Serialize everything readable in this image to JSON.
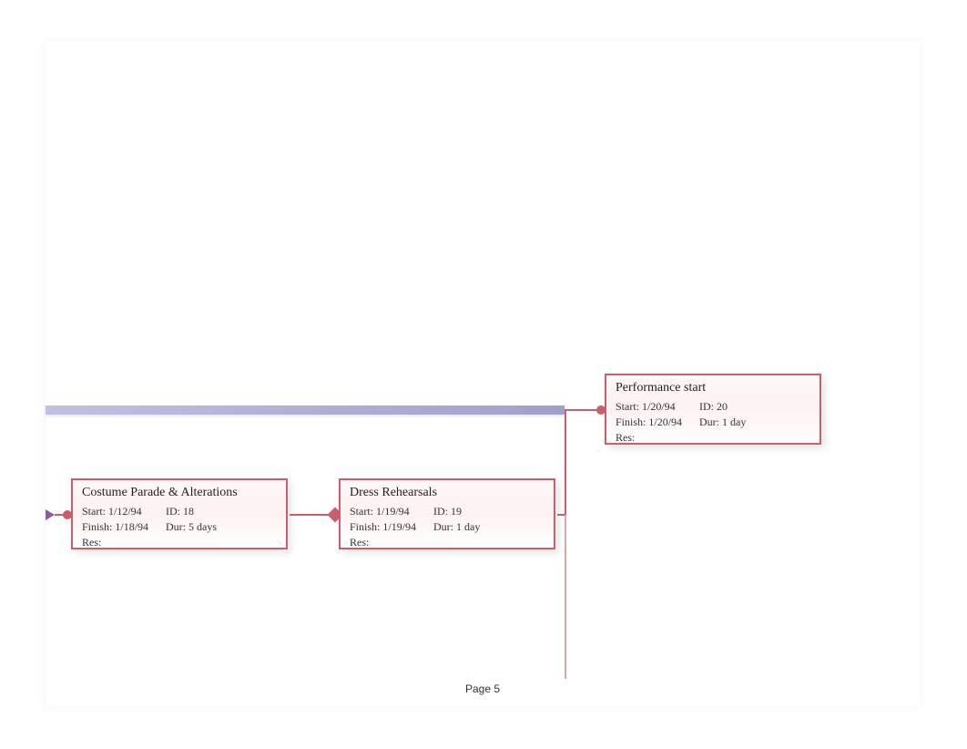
{
  "footer": {
    "page_label": "Page 5"
  },
  "labels": {
    "start": "Start:",
    "finish": "Finish:",
    "id": "ID:",
    "dur": "Dur:",
    "res": "Res:"
  },
  "tasks": {
    "t1": {
      "title": "Costume Parade & Alterations",
      "start": "1/12/94",
      "finish": "1/18/94",
      "id": "18",
      "dur": "5 days",
      "res": ""
    },
    "t2": {
      "title": "Dress Rehearsals",
      "start": "1/19/94",
      "finish": "1/19/94",
      "id": "19",
      "dur": "1 day",
      "res": ""
    },
    "t3": {
      "title": "Performance start",
      "start": "1/20/94",
      "finish": "1/20/94",
      "id": "20",
      "dur": "1 day",
      "res": ""
    }
  }
}
